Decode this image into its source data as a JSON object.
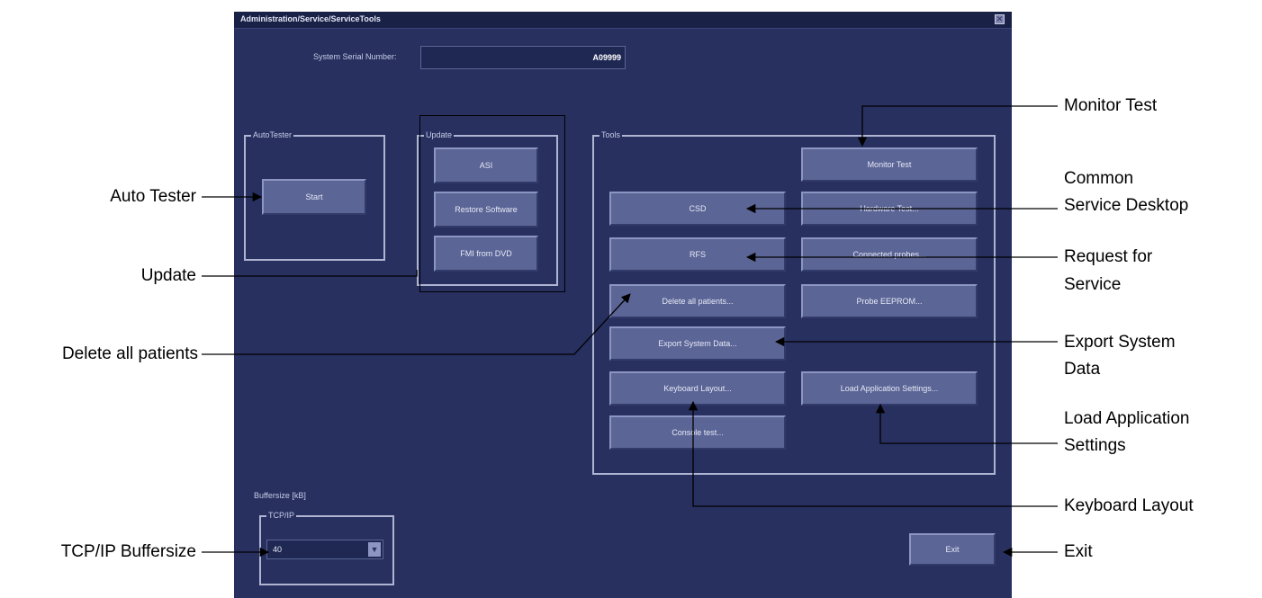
{
  "window": {
    "title": "Administration/Service/ServiceTools"
  },
  "serial": {
    "label": "System Serial Number:",
    "value": "A09999"
  },
  "autotester": {
    "group_label": "AutoTester",
    "start_label": "Start"
  },
  "update": {
    "group_label": "Update",
    "asi_label": "ASI",
    "restore_label": "Restore Software",
    "fmi_label": "FMI from DVD"
  },
  "tools": {
    "group_label": "Tools",
    "monitor_test": "Monitor Test",
    "csd": "CSD",
    "hardware_test": "Hardware Test...",
    "rfs": "RFS",
    "connected_probes": "Connected probes...",
    "delete_patients": "Delete all patients...",
    "probe_eeprom": "Probe EEPROM...",
    "export_system_data": "Export System Data...",
    "keyboard_layout": "Keyboard Layout...",
    "load_app_settings": "Load Application Settings...",
    "console_test": "Console test..."
  },
  "buffer": {
    "label": "Buffersize [kB]",
    "group_label": "TCP/IP",
    "value": "40"
  },
  "exit_label": "Exit",
  "callouts": {
    "monitor_test": "Monitor Test",
    "csd_line1": "Common",
    "csd_line2": "Service Desktop",
    "rfs_line1": "Request for",
    "rfs_line2": "Service",
    "export_line1": "Export System",
    "export_line2": "Data",
    "load_line1": "Load Application",
    "load_line2": "Settings",
    "keyboard_layout": "Keyboard Layout",
    "exit": "Exit",
    "auto_tester": "Auto Tester",
    "update": "Update",
    "delete_all_patients": "Delete all patients",
    "tcpip_buffersize": "TCP/IP Buffersize"
  }
}
